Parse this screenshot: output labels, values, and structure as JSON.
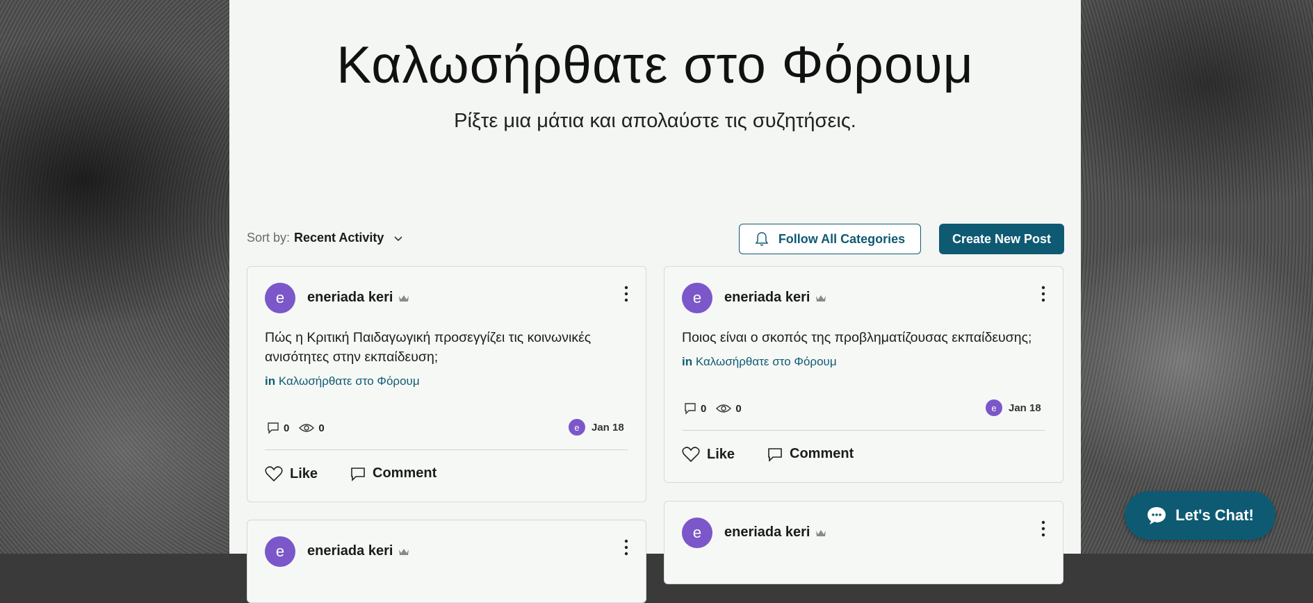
{
  "hero": {
    "title": "Καλωσήρθατε στο Φόρουμ",
    "subtitle": "Ρίξτε μια μάτια και απολαύστε τις συζητήσεις."
  },
  "toolbar": {
    "sort_label": "Sort by:",
    "sort_value": "Recent Activity",
    "follow_label": "Follow All Categories",
    "create_label": "Create New Post"
  },
  "posts": [
    {
      "avatar_letter": "e",
      "author": "eneriada keri",
      "title_line1": "Πώς η Κριτική Παιδαγωγική προσεγγίζει τις κοινωνικές",
      "title_line2": "ανισότητες στην εκπαίδευση;",
      "category_prefix": "in",
      "category": "Καλωσήρθατε στο Φόρουμ",
      "comments": "0",
      "views": "0",
      "date": "Jan 18",
      "like_label": "Like",
      "comment_label": "Comment"
    },
    {
      "avatar_letter": "e",
      "author": "eneriada keri",
      "title_line1": "Ποιος είναι ο σκοπός της προβληματίζουσας εκπαίδευσης;",
      "category_prefix": "in",
      "category": "Καλωσήρθατε στο Φόρουμ",
      "comments": "0",
      "views": "0",
      "date": "Jan 18",
      "like_label": "Like",
      "comment_label": "Comment"
    },
    {
      "avatar_letter": "e",
      "author": "eneriada keri"
    },
    {
      "avatar_letter": "e",
      "author": "eneriada keri"
    }
  ],
  "chat": {
    "label": "Let's Chat!"
  },
  "colors": {
    "accent": "#0e5a73",
    "avatar": "#7b57c9"
  },
  "icons": [
    "bell-icon",
    "chevron-down-icon",
    "crown-icon",
    "kebab-icon",
    "comment-icon",
    "eye-icon",
    "heart-icon",
    "chat-bubble-icon"
  ]
}
